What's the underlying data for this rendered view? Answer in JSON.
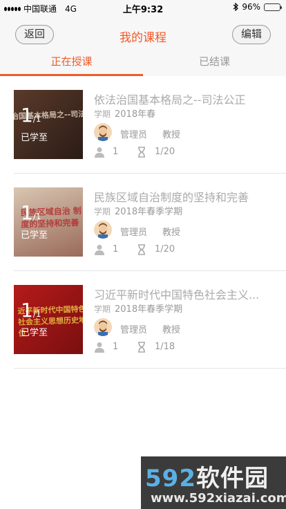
{
  "status_bar": {
    "carrier": "中国联通",
    "network": "4G",
    "time": "上午9:32",
    "battery_text": "96%",
    "battery_level": 0.96
  },
  "nav": {
    "back_label": "返回",
    "title": "我的课程",
    "edit_label": "编辑"
  },
  "tabs": [
    {
      "label": "正在授课",
      "active": true
    },
    {
      "label": "已结课",
      "active": false
    }
  ],
  "labels": {
    "term": "学期",
    "learned": "已学至"
  },
  "courses": [
    {
      "title": "依法治国基本格局之--司法公正",
      "term": "2018年春",
      "progress_current": "1",
      "progress_total": "/1",
      "role": "管理员",
      "rank": "教授",
      "students": "1",
      "lessons": "1/20",
      "thumb_text": "治国基本格局之--司法",
      "thumb_colors": [
        "#5b3a2a",
        "#2a1c16"
      ]
    },
    {
      "title": "民族区域自治制度的坚持和完善",
      "term": "2018年春季学期",
      "progress_current": "1",
      "progress_total": "/1",
      "role": "管理员",
      "rank": "教授",
      "students": "1",
      "lessons": "1/20",
      "thumb_text": "民族区域自治 制度的坚持和完善",
      "thumb_colors": [
        "#c9b5a3",
        "#8a5a4a"
      ]
    },
    {
      "title": "习近平新时代中国特色社会主义...",
      "term": "2018年春季学期",
      "progress_current": "1",
      "progress_total": "/1",
      "role": "管理员",
      "rank": "教授",
      "students": "1",
      "lessons": "1/18",
      "thumb_text": "近平新时代中国特色 社会主义思想历史地位",
      "thumb_colors": [
        "#b51a1a",
        "#7a0f0f"
      ]
    }
  ],
  "watermark": {
    "number": "592",
    "brand": "软件园",
    "url": "www.592xiazai.com"
  },
  "icons": {
    "signal": "signal-dots-icon",
    "bluetooth": "bluetooth-icon",
    "battery": "battery-icon",
    "user": "user-icon",
    "hourglass": "hourglass-icon",
    "avatar": "teacher-avatar"
  },
  "colors": {
    "accent": "#f05a28",
    "text_muted": "#999999"
  }
}
